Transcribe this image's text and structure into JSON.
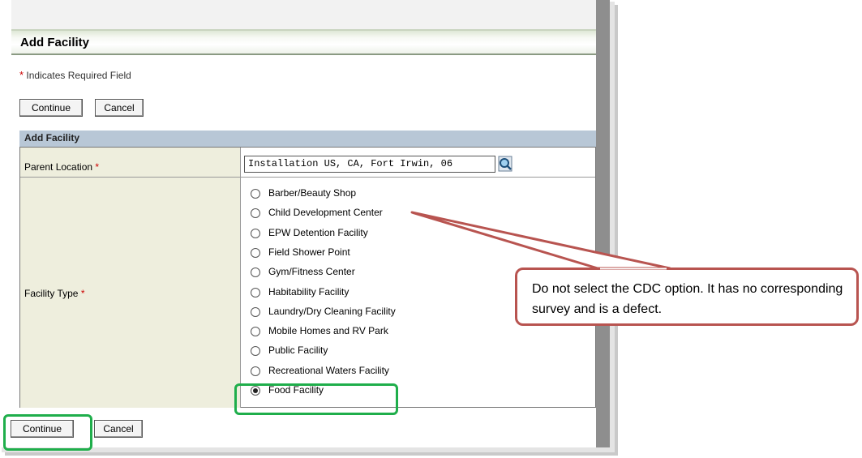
{
  "header": {
    "title": "Add Facility"
  },
  "required_note": {
    "star": "*",
    "text": "Indicates Required Field"
  },
  "buttons": {
    "continue": "Continue",
    "cancel": "Cancel"
  },
  "section": {
    "title": "Add Facility"
  },
  "form": {
    "parent_location": {
      "label": "Parent Location",
      "star": "*",
      "value": "Installation US, CA, Fort Irwin, 06"
    },
    "facility_type": {
      "label": "Facility Type",
      "star": "*",
      "options": [
        {
          "label": "Barber/Beauty Shop",
          "selected": false
        },
        {
          "label": "Child Development Center",
          "selected": false
        },
        {
          "label": "EPW Detention Facility",
          "selected": false
        },
        {
          "label": "Field Shower Point",
          "selected": false
        },
        {
          "label": "Gym/Fitness Center",
          "selected": false
        },
        {
          "label": "Habitability Facility",
          "selected": false
        },
        {
          "label": "Laundry/Dry Cleaning Facility",
          "selected": false
        },
        {
          "label": "Mobile Homes and RV Park",
          "selected": false
        },
        {
          "label": "Public Facility",
          "selected": false
        },
        {
          "label": "Recreational Waters Facility",
          "selected": false
        },
        {
          "label": "Food Facility",
          "selected": true
        }
      ]
    }
  },
  "callout": {
    "text": "Do not select the CDC option. It has no corresponding survey and is a defect."
  },
  "colors": {
    "highlight": "#1fae4b",
    "callout_border": "#b85450",
    "section_head": "#b8c7d6",
    "label_bg": "#eeeedd"
  }
}
